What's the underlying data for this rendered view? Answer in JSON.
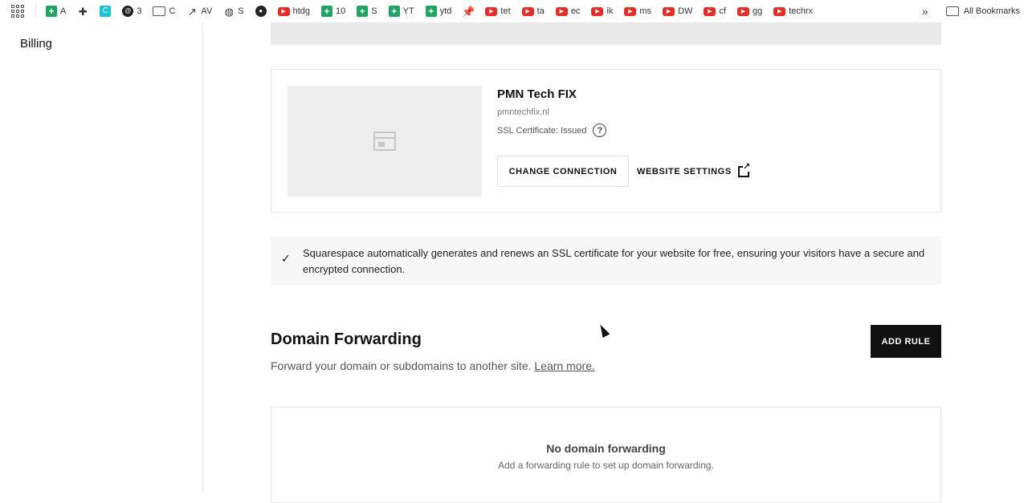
{
  "bookmarks": {
    "items": [
      {
        "icon": "sheets-icon",
        "label": "A"
      },
      {
        "icon": "puzzle-icon",
        "label": ""
      },
      {
        "icon": "cyan-app-icon",
        "label": ""
      },
      {
        "icon": "threads-icon",
        "label": "3"
      },
      {
        "icon": "folder-icon",
        "label": "C"
      },
      {
        "icon": "trend-icon",
        "label": "AV"
      },
      {
        "icon": "globe-icon",
        "label": "S"
      },
      {
        "icon": "github-icon",
        "label": ""
      },
      {
        "icon": "youtube-icon",
        "label": "htdg"
      },
      {
        "icon": "sheets-icon",
        "label": "10"
      },
      {
        "icon": "sheets-icon",
        "label": "S"
      },
      {
        "icon": "sheets-icon",
        "label": "YT"
      },
      {
        "icon": "sheets-icon",
        "label": "ytd"
      },
      {
        "icon": "pin-icon",
        "label": ""
      },
      {
        "icon": "youtube-icon",
        "label": "tet"
      },
      {
        "icon": "youtube-icon",
        "label": "ta"
      },
      {
        "icon": "youtube-icon",
        "label": "ec"
      },
      {
        "icon": "youtube-icon",
        "label": "ik"
      },
      {
        "icon": "youtube-icon",
        "label": "ms"
      },
      {
        "icon": "youtube-icon",
        "label": "DW"
      },
      {
        "icon": "youtube-icon",
        "label": "cf"
      },
      {
        "icon": "youtube-icon",
        "label": "gg"
      },
      {
        "icon": "youtube-icon",
        "label": "techrx"
      }
    ],
    "more_glyph": "»",
    "all_bookmarks": "All Bookmarks"
  },
  "sidebar": {
    "billing_label": "Billing"
  },
  "domain_card": {
    "site_title": "PMN Tech FIX",
    "site_url": "pmntechfix.nl",
    "ssl_status": "SSL Certificate: Issued",
    "help_glyph": "?",
    "change_connection_label": "CHANGE CONNECTION",
    "website_settings_label": "WEBSITE SETTINGS"
  },
  "notice": {
    "text": "Squarespace automatically generates and renews an SSL certificate for your website for free, ensuring your visitors have a secure and encrypted connection."
  },
  "forwarding": {
    "title": "Domain Forwarding",
    "description": "Forward your domain or subdomains to another site.",
    "learn_more": "Learn more.",
    "add_rule_label": "ADD RULE",
    "empty_title": "No domain forwarding",
    "empty_subtitle": "Add a forwarding rule to set up domain forwarding."
  },
  "colors": {
    "sheets": "#1fa463",
    "youtube": "#e52d27",
    "button_dark": "#111111"
  }
}
